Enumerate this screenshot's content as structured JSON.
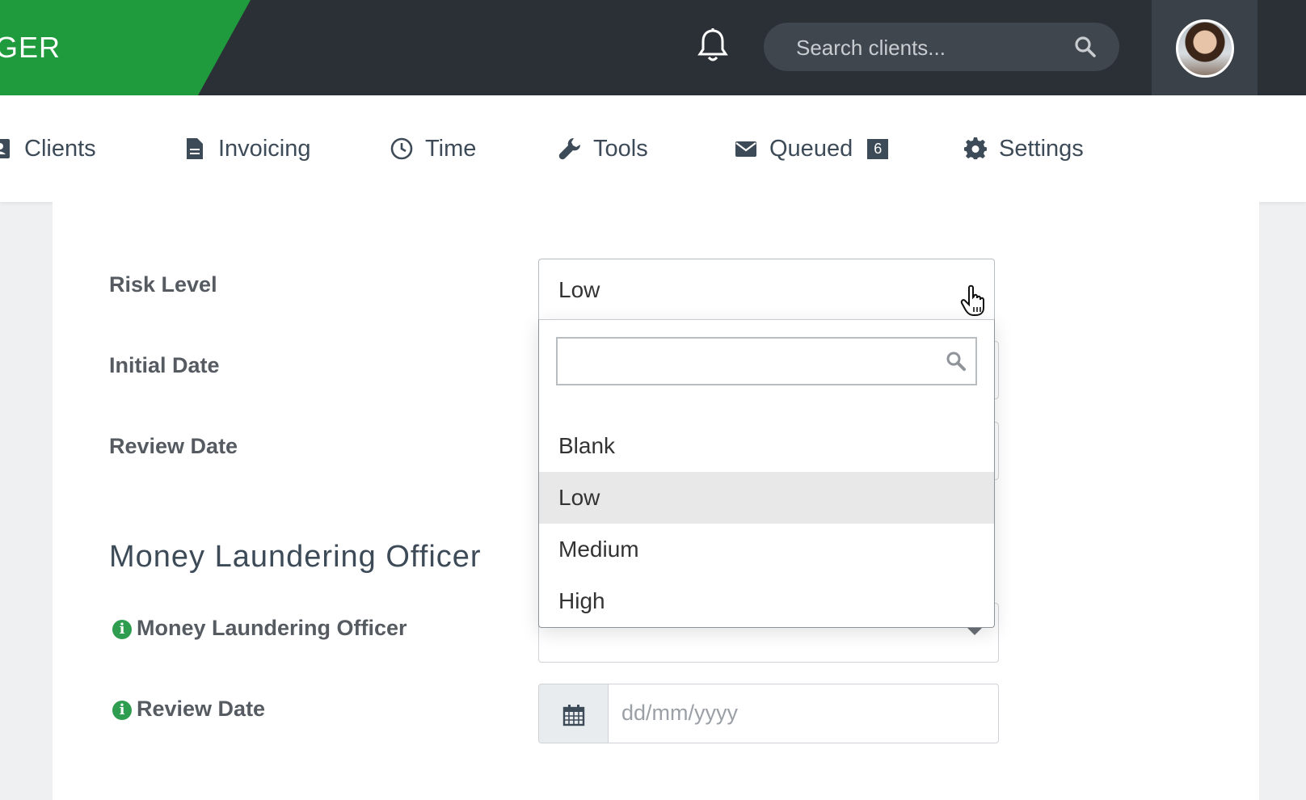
{
  "header": {
    "brand_text": "GER",
    "search_placeholder": "Search clients...",
    "colors": {
      "brand": "#1f9a3c",
      "topbar": "#2b3036"
    }
  },
  "nav": {
    "items": [
      {
        "label": "Clients",
        "icon": "contact-card-icon"
      },
      {
        "label": "Invoicing",
        "icon": "document-icon"
      },
      {
        "label": "Time",
        "icon": "clock-icon"
      },
      {
        "label": "Tools",
        "icon": "wrench-icon"
      },
      {
        "label": "Queued",
        "icon": "envelope-icon",
        "badge": "6"
      },
      {
        "label": "Settings",
        "icon": "gear-icon"
      }
    ]
  },
  "form": {
    "risk_level_label": "Risk Level",
    "initial_date_label": "Initial Date",
    "review_date_label": "Review Date",
    "mlo_section_title": "Money Laundering Officer",
    "mlo_label": "Money Laundering Officer",
    "mlo_review_date_label": "Review Date",
    "date_placeholder": "dd/mm/yyyy"
  },
  "risk_dropdown": {
    "selected": "Low",
    "search_value": "",
    "options": [
      "Blank",
      "Low",
      "Medium",
      "High"
    ],
    "highlighted": "Low"
  }
}
